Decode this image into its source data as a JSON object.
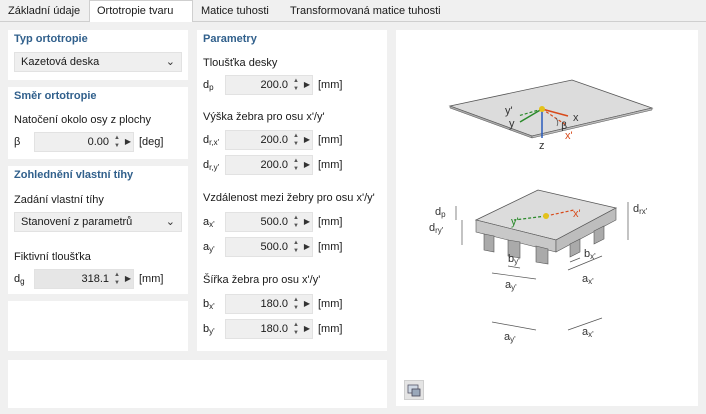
{
  "tabs": [
    "Základní údaje",
    "Ortotropie tvaru",
    "Matice tuhosti",
    "Transformovaná matice tuhosti"
  ],
  "typ": {
    "title": "Typ ortotropie",
    "value": "Kazetová deska"
  },
  "smer": {
    "title": "Směr ortotropie",
    "label": "Natočení okolo osy z plochy",
    "sym": "β",
    "value": "0.00",
    "unit": "[deg]"
  },
  "tihy": {
    "title": "Zohlednění vlastní tíhy",
    "label": "Zadání vlastní tíhy",
    "value": "Stanovení z parametrů",
    "fik_label": "Fiktivní tloušťka",
    "fik_sym": "d",
    "fik_sub": "g",
    "fik_value": "318.1",
    "fik_unit": "[mm]"
  },
  "param": {
    "title": "Parametry",
    "tl_label": "Tloušťka desky",
    "dp": {
      "sym": "d",
      "sub": "p",
      "value": "200.0",
      "unit": "[mm]"
    },
    "vyska_label": "Výška žebra pro osu x'/y'",
    "drx": {
      "sym": "d",
      "sub": "r,x'",
      "value": "200.0",
      "unit": "[mm]"
    },
    "dry": {
      "sym": "d",
      "sub": "r,y'",
      "value": "200.0",
      "unit": "[mm]"
    },
    "vzd_label": "Vzdálenost mezi žebry pro osu x'/y'",
    "ax": {
      "sym": "a",
      "sub": "x'",
      "value": "500.0",
      "unit": "[mm]"
    },
    "ay": {
      "sym": "a",
      "sub": "y'",
      "value": "500.0",
      "unit": "[mm]"
    },
    "sir_label": "Šířka žebra pro osu x'/y'",
    "bx": {
      "sym": "b",
      "sub": "x'",
      "value": "180.0",
      "unit": "[mm]"
    },
    "by": {
      "sym": "b",
      "sub": "y'",
      "value": "180.0",
      "unit": "[mm]"
    }
  },
  "diagram": {
    "y_prime": "y'",
    "y": "y",
    "beta": "β",
    "x": "x",
    "x_prime": "x'",
    "z": "z",
    "dp": "d",
    "dp_sub": "p",
    "dry": "d",
    "dry_sub": "ry'",
    "drx": "d",
    "drx_sub": "rx'",
    "y2": "y'",
    "x2": "x'",
    "by1": "b",
    "by1_sub": "y'",
    "bx1": "b",
    "bx1_sub": "x'",
    "ay1": "a",
    "ay1_sub": "y'",
    "ax1": "a",
    "ax1_sub": "x'",
    "ay2": "a",
    "ay2_sub": "y'",
    "ax2": "a",
    "ax2_sub": "x'"
  }
}
